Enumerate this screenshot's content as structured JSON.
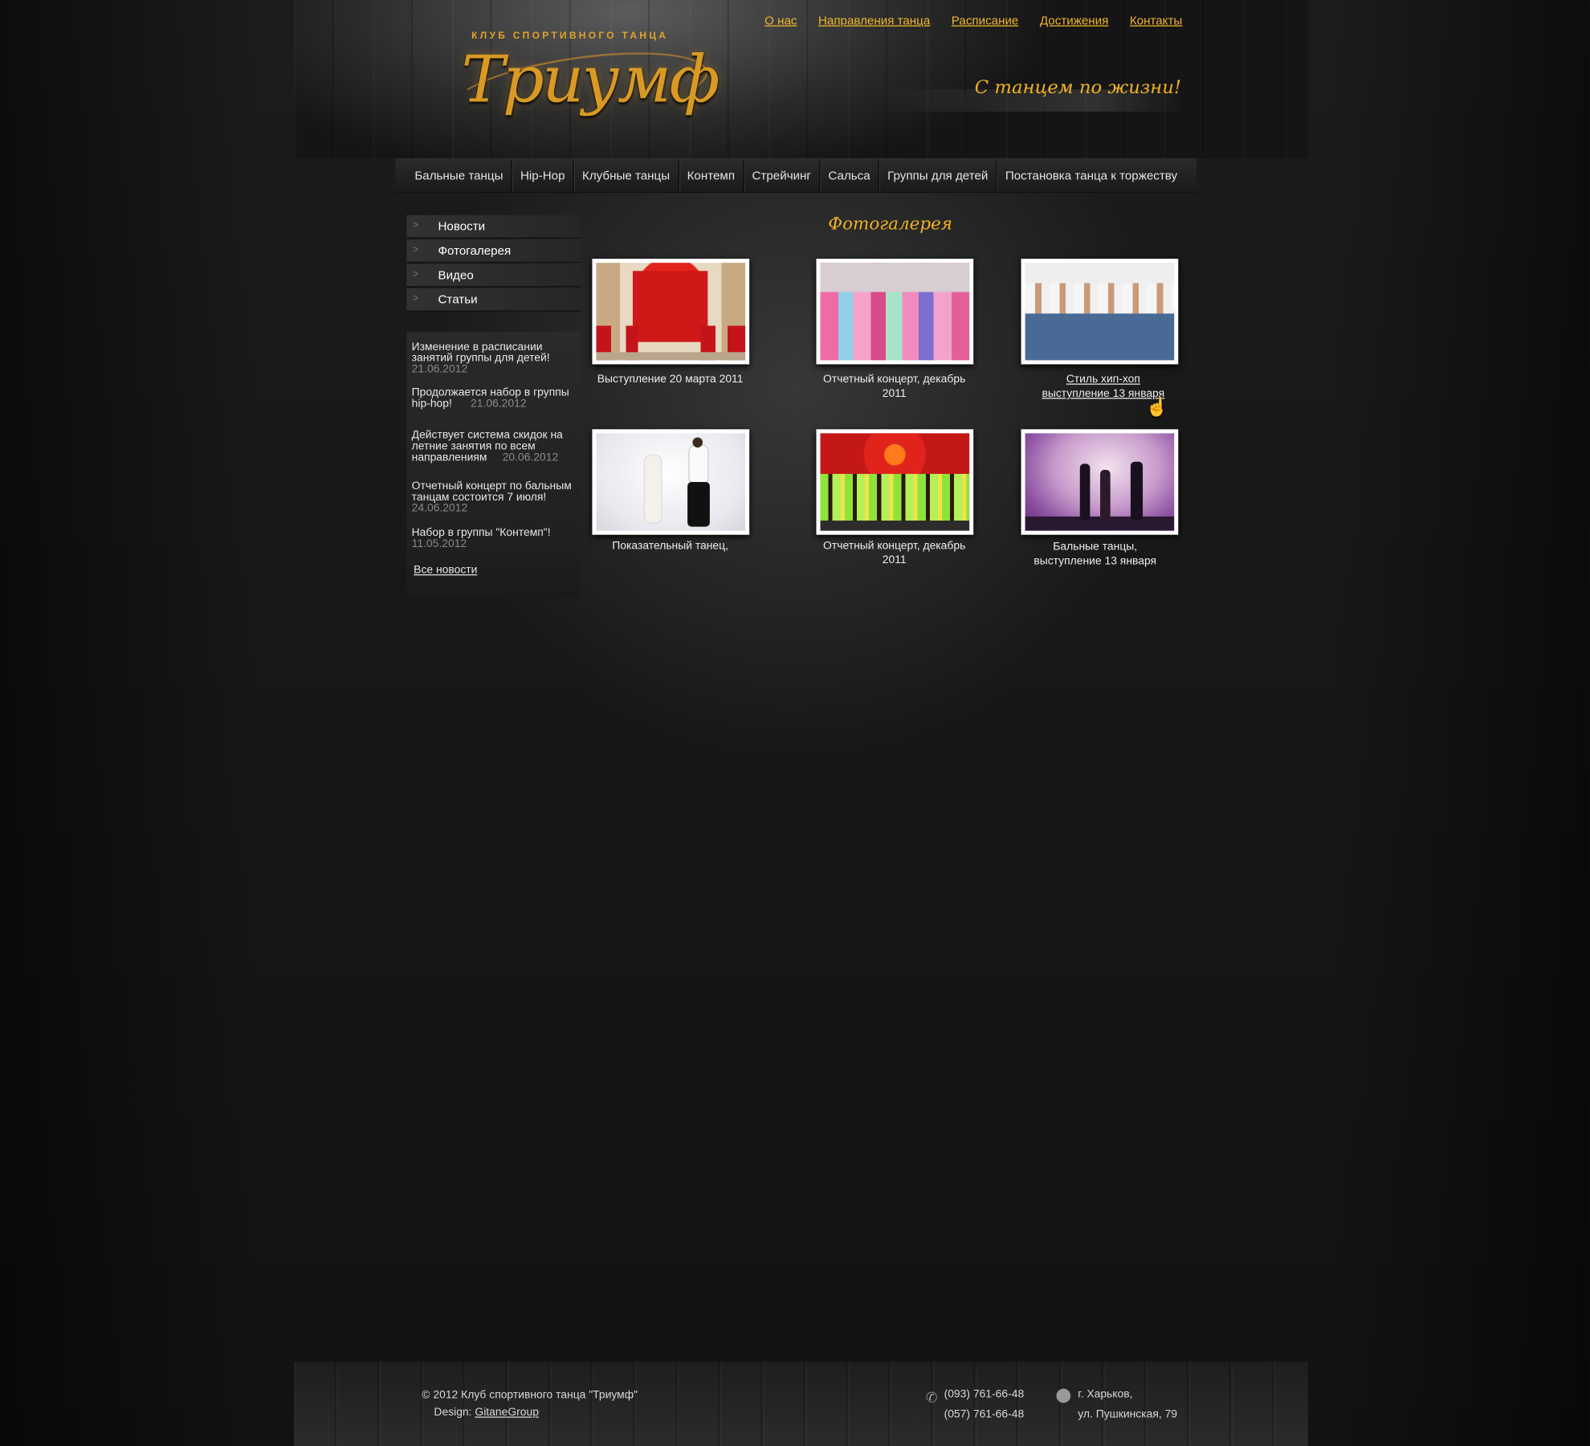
{
  "header": {
    "logo_club": "Клуб спортивного танца",
    "logo_name": "Триумф",
    "slogan": "С танцем по жизни!",
    "top_nav": [
      "О нас",
      "Направления танца",
      "Расписание",
      "Достижения",
      "Контакты"
    ]
  },
  "main_nav": [
    "Бальные танцы",
    "Hip-Hop",
    "Клубные танцы",
    "Контемп",
    "Стрейчинг",
    "Сальса",
    "Группы для детей",
    "Постановка танца к торжеству"
  ],
  "sidebar": {
    "menu": [
      "Новости",
      "Фотогалерея",
      "Видео",
      "Статьи"
    ],
    "news": [
      {
        "text": "Изменение в расписании занятий группы для детей!",
        "date": "21.06.2012"
      },
      {
        "text": "Продолжается набор в группы hip-hop!",
        "date": "21.06.2012"
      },
      {
        "text": "Действует система скидок на летние занятия по всем направлениям",
        "date": "20.06.2012"
      },
      {
        "text": "Отчетный концерт по бальным танцам состоится 7 июля!",
        "date": "24.06.2012"
      },
      {
        "text": "Набор в группы \"Контемп\"!",
        "date": "11.05.2012"
      }
    ],
    "all_news": "Все новости"
  },
  "gallery": {
    "title": "Фотогалерея",
    "items": [
      {
        "caption1": "Выступление 20 марта 2011",
        "caption2": ""
      },
      {
        "caption1": "Отчетный концерт, декабрь",
        "caption2": "2011"
      },
      {
        "caption1": "Стиль хип-хоп",
        "caption2": "выступление 13 января"
      },
      {
        "caption1": "Показательный танец,",
        "caption2": ""
      },
      {
        "caption1": "Отчетный концерт, декабрь",
        "caption2": "2011"
      },
      {
        "caption1": "Бальные танцы,",
        "caption2": "выступление 13 января"
      }
    ]
  },
  "footer": {
    "copyright": "©  2012 Клуб спортивного танца \"Триумф\"",
    "design_label": "Design:",
    "design_link": "GitaneGroup",
    "phone1": "(093) 761-66-48",
    "phone2": "(057) 761-66-48",
    "city": "г. Харьков,",
    "street": "ул. Пушкинская, 79"
  },
  "colors": {
    "accent": "#f0b224",
    "background": "#161616"
  }
}
